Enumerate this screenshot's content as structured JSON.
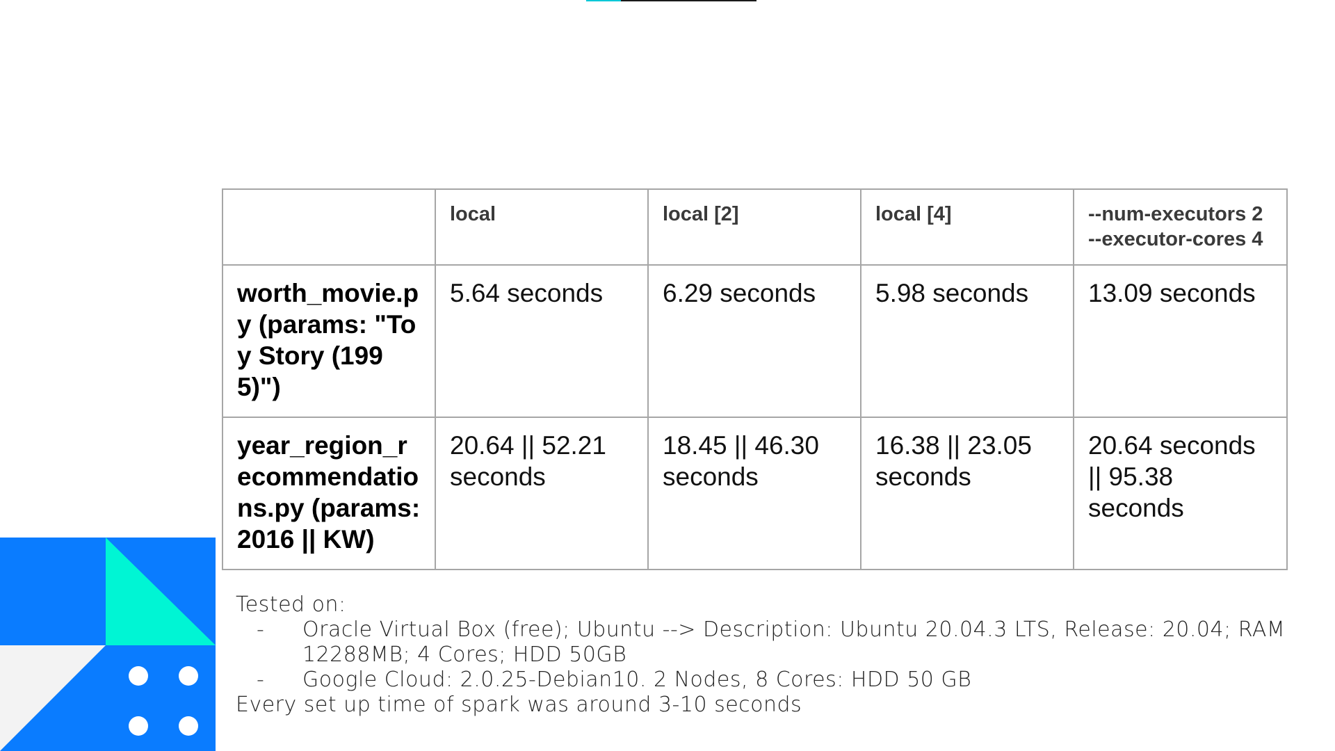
{
  "table": {
    "headers": [
      "",
      "local",
      "local [2]",
      "local [4]",
      "--num-executors 2 --executor-cores 4"
    ],
    "rows": [
      {
        "label": "worth_movie.py (params: \"Toy Story (1995)\")",
        "values": [
          "5.64 seconds",
          "6.29 seconds",
          "5.98 seconds",
          "13.09 seconds"
        ]
      },
      {
        "label": "year_region_recommendations.py (params: 2016 || KW)",
        "values": [
          "20.64 || 52.21 seconds",
          "18.45 || 46.30 seconds",
          "16.38 || 23.05 seconds",
          "20.64 seconds || 95.38 seconds"
        ]
      }
    ]
  },
  "notes": {
    "heading": "Tested on:",
    "bullets": [
      {
        "dash": "-",
        "text": "Oracle Virtual Box (free); Ubuntu --> Description:    Ubuntu 20.04.3 LTS, Release:    20.04; RAM 12288MB; 4 Cores; HDD 50GB"
      },
      {
        "dash": "-",
        "text": "Google Cloud:  2.0.25-Debian10. 2 Nodes, 8 Cores: HDD 50 GB"
      }
    ],
    "footer": "Every set up time of spark  was around 3-10 seconds"
  },
  "colors": {
    "brand_blue": "#0a7cff",
    "accent_teal": "#00f5d4",
    "light_gray": "#f3f3f3",
    "border_gray": "#a6a6a6"
  }
}
